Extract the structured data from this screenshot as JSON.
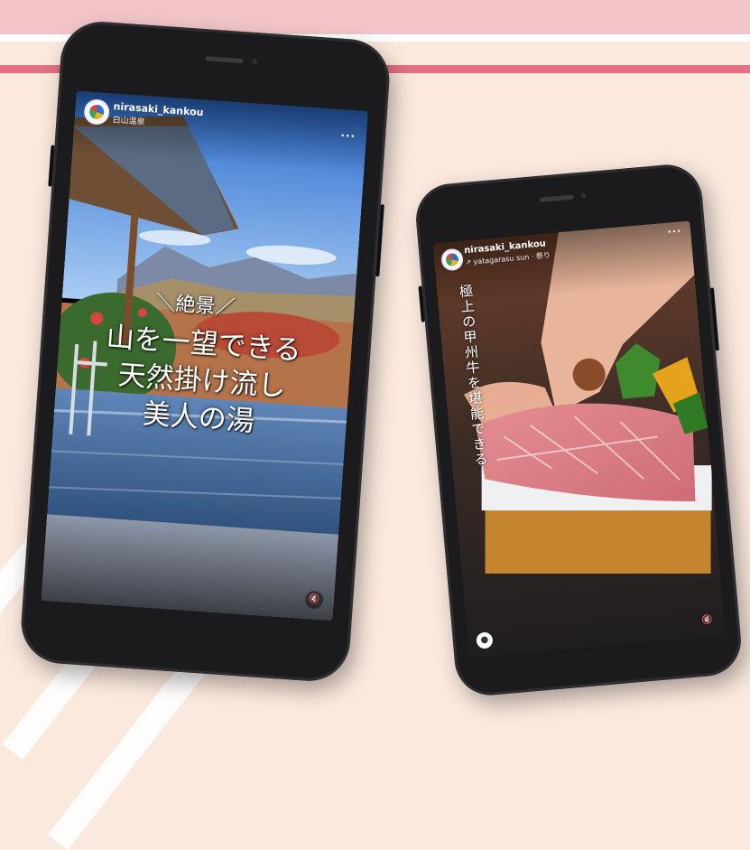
{
  "phones": [
    {
      "username": "nirasaki_kankou",
      "location": "白山温泉",
      "more_glyph": "···",
      "caption": {
        "kicker": "＼絶景／",
        "lines": [
          "山を一望できる",
          "天然掛け流し",
          "美人の湯"
        ]
      },
      "mute_glyph": "🔇"
    },
    {
      "username": "nirasaki_kankou",
      "audio": "↗ yatagarasu sun · 祭り",
      "more_glyph": "···",
      "caption": "極上の甲州牛を堪能できる",
      "mute_glyph": "🔇",
      "profile_glyph": "●"
    }
  ]
}
